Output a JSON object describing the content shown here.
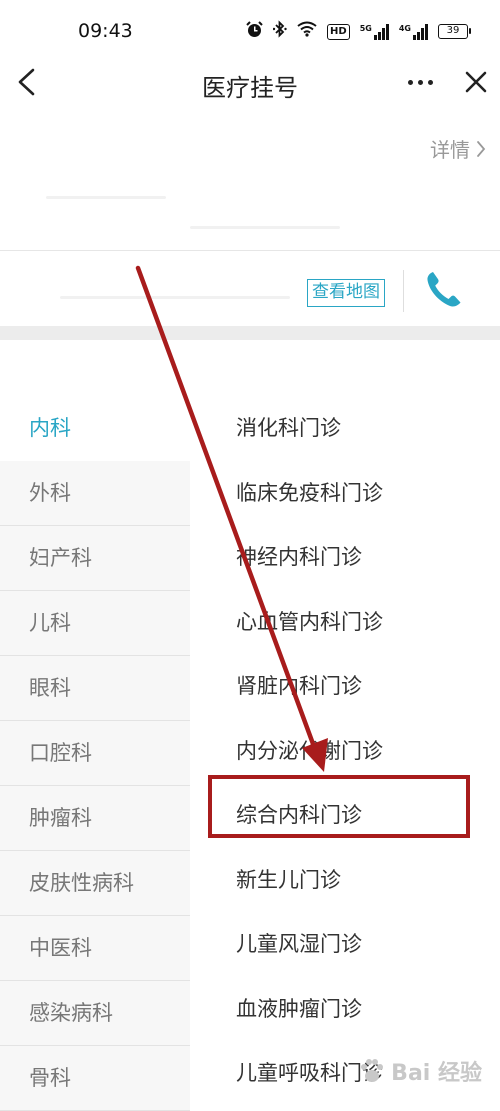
{
  "status_bar": {
    "time": "09:43",
    "alarm_icon": "alarm-clock-icon",
    "bluetooth_icon": "bluetooth-icon",
    "wifi_icon": "wifi-icon",
    "hd_badge": "HD",
    "signal_1_label": "5G",
    "signal_2_label": "4G",
    "battery_level": "39"
  },
  "nav": {
    "title": "医疗挂号",
    "back_icon": "chevron-left-icon",
    "more_icon": "more-dots-icon",
    "close_icon": "close-icon"
  },
  "hospital": {
    "detail_label": "详情",
    "map_button": "查看地图",
    "phone_icon": "phone-icon"
  },
  "departments": [
    "内科",
    "外科",
    "妇产科",
    "儿科",
    "眼科",
    "口腔科",
    "肿瘤科",
    "皮肤性病科",
    "中医科",
    "感染病科",
    "骨科"
  ],
  "selected_department": "内科",
  "clinics": [
    "消化科门诊",
    "临床免疫科门诊",
    "神经内科门诊",
    "心血管内科门诊",
    "肾脏内科门诊",
    "内分泌代谢门诊",
    "综合内科门诊",
    "新生儿门诊",
    "儿童风湿门诊",
    "血液肿瘤门诊",
    "儿童呼吸科门诊"
  ],
  "highlighted_clinic": "综合内科门诊",
  "colors": {
    "accent": "#2aa6c5",
    "annotation": "#a81c1c",
    "sidebar_bg": "#f7f7f7"
  },
  "watermark": {
    "text": "Bai 经验",
    "icon": "baidu-paw-icon"
  }
}
